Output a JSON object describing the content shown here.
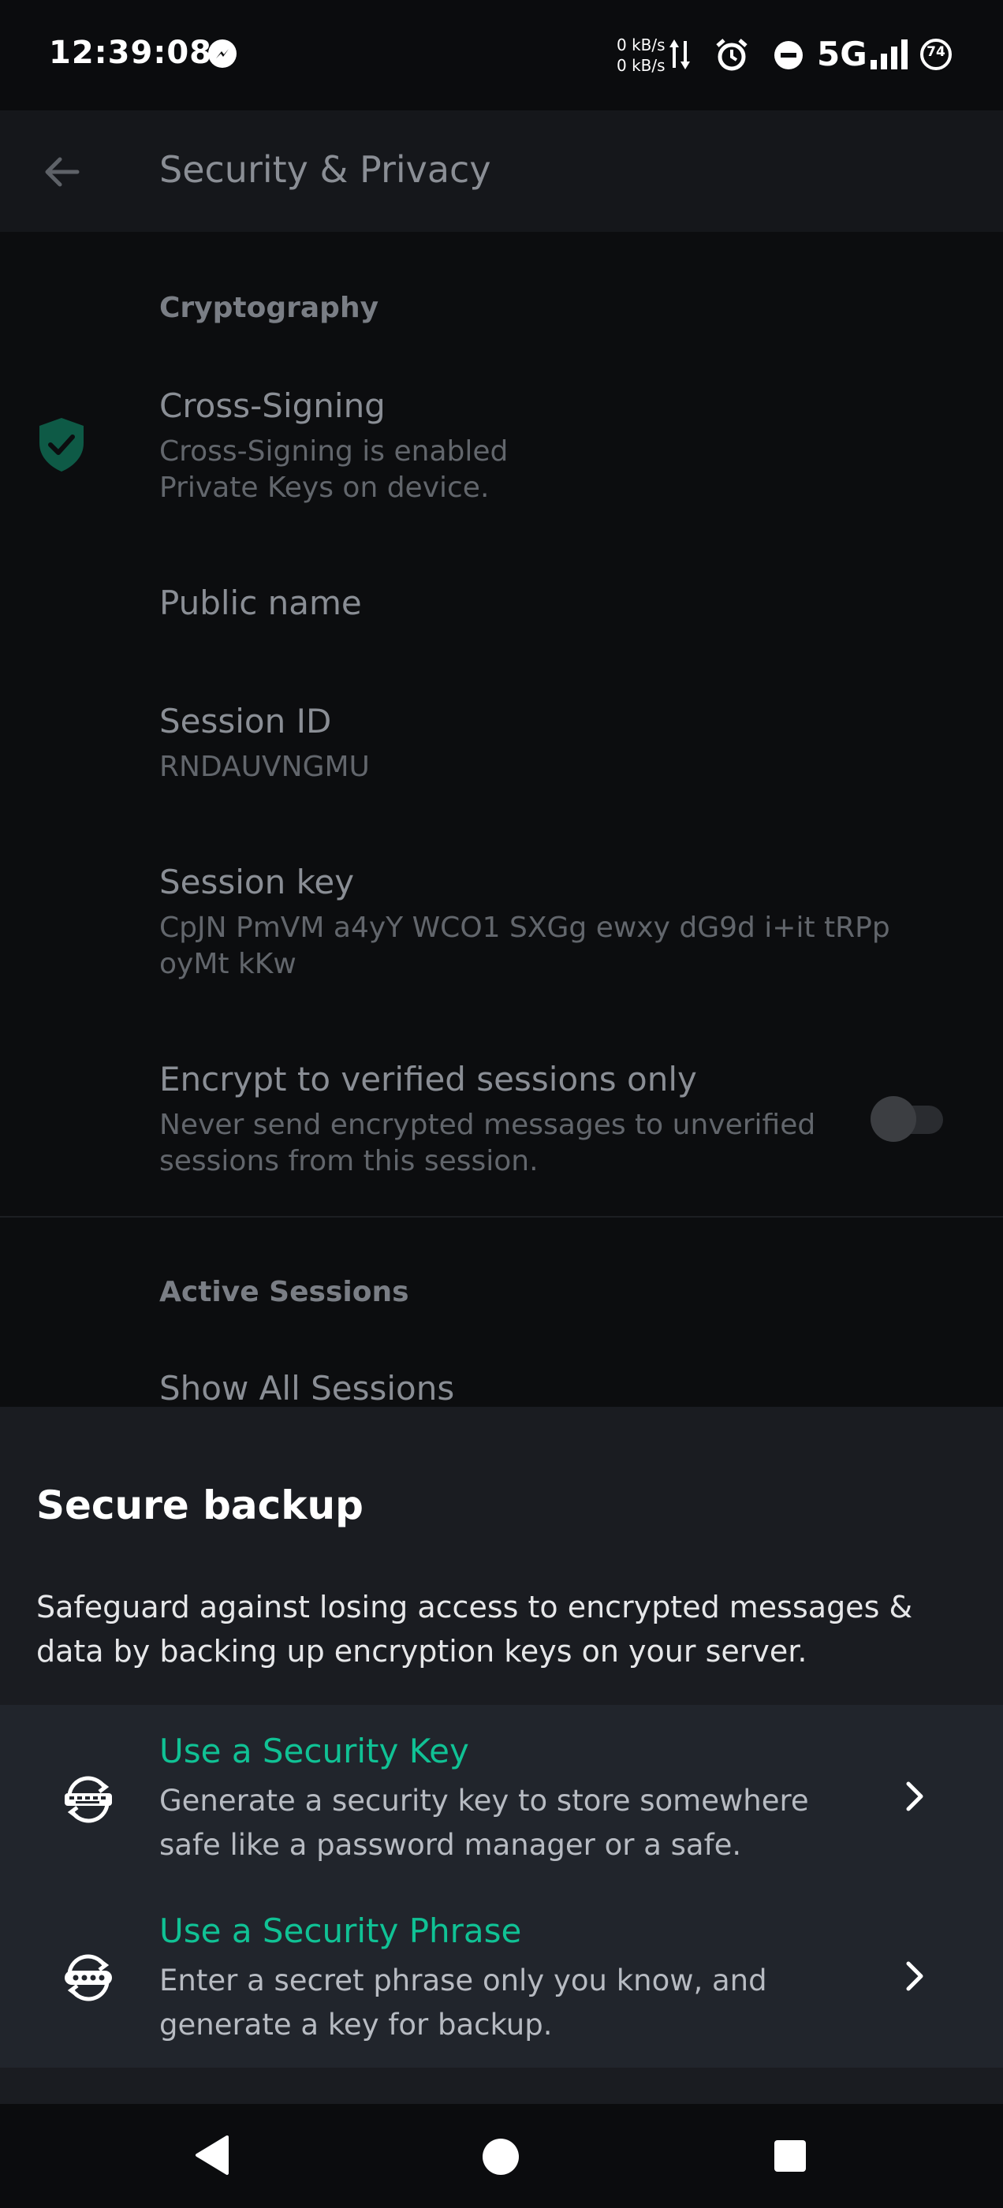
{
  "status_bar": {
    "time": "12:39:08",
    "net_up": "0 kB/s",
    "net_down": "0 kB/s",
    "network": "5G",
    "battery": "74",
    "icons": [
      "messenger-icon",
      "data-arrows-icon",
      "alarm-icon",
      "dnd-icon",
      "signal-icon",
      "battery-icon"
    ]
  },
  "app_bar": {
    "title": "Security & Privacy",
    "back_icon": "arrow-left-icon"
  },
  "settings": {
    "cryptography_header": "Cryptography",
    "cross_signing": {
      "title": "Cross-Signing",
      "subtitle_line1": "Cross-Signing is enabled",
      "subtitle_line2": "Private Keys on device.",
      "icon": "shield-check-icon"
    },
    "public_name": {
      "title": "Public name"
    },
    "session_id": {
      "title": "Session ID",
      "value": "RNDAUVNGMU"
    },
    "session_key": {
      "title": "Session key",
      "value": "CpJN PmVM a4yY WCO1 SXGg ewxy dG9d i+it tRPp oyMt kKw"
    },
    "encrypt_verified": {
      "title": "Encrypt to verified sessions only",
      "subtitle": "Never send encrypted messages to unverified sessions from this session.",
      "toggle_on": false
    },
    "active_sessions_header": "Active Sessions",
    "show_all_sessions": "Show All Sessions"
  },
  "sheet": {
    "title": "Secure backup",
    "description": "Safeguard against losing access to encrypted messages & data by backing up encryption keys on your server.",
    "options": [
      {
        "title": "Use a Security Key",
        "subtitle": "Generate a security key to store somewhere safe like a password manager or a safe.",
        "icon": "key-sync-icon"
      },
      {
        "title": "Use a Security Phrase",
        "subtitle": "Enter a secret phrase only you know, and generate a key for backup.",
        "icon": "phrase-sync-icon"
      }
    ]
  },
  "nav_bar": {
    "icons": [
      "back-triangle-icon",
      "home-circle-icon",
      "recents-square-icon"
    ]
  },
  "colors": {
    "accent": "#10c295",
    "sheet_bg": "#1a1c21",
    "option_bg": "#21252c"
  }
}
